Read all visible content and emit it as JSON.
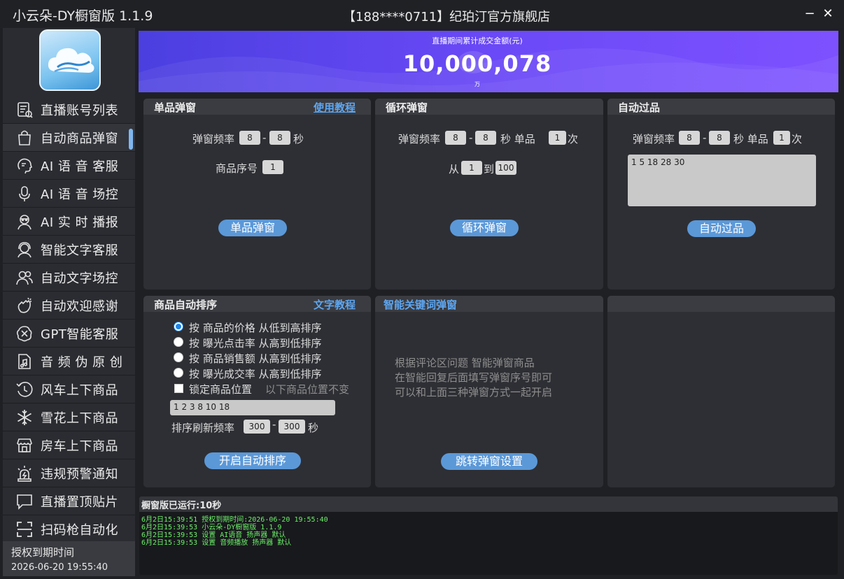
{
  "window": {
    "app_title": "小云朵-DY橱窗版 1.1.9",
    "shop_title": "【188****0711】纪珀汀官方旗舰店",
    "minimize_symbol": "−",
    "close_symbol": "✕"
  },
  "sidebar": {
    "items": [
      {
        "label": "直播账号列表",
        "icon": "account-list-icon"
      },
      {
        "label": "自动商品弹窗",
        "icon": "shopping-bag-icon"
      },
      {
        "label": "AI 语 音 客服",
        "icon": "ai-voice-service-icon"
      },
      {
        "label": "AI 语 音 场控",
        "icon": "microphone-icon"
      },
      {
        "label": "AI 实 时 播报",
        "icon": "broadcaster-icon"
      },
      {
        "label": "智能文字客服",
        "icon": "support-agent-icon"
      },
      {
        "label": "自动文字场控",
        "icon": "users-icon"
      },
      {
        "label": "自动欢迎感谢",
        "icon": "welcome-hand-icon"
      },
      {
        "label": "GPT智能客服",
        "icon": "gpt-icon"
      },
      {
        "label": "音 频 伪 原 创",
        "icon": "music-file-icon"
      },
      {
        "label": "风车上下商品",
        "icon": "clock-history-icon"
      },
      {
        "label": "雪花上下商品",
        "icon": "snowflake-icon"
      },
      {
        "label": "房车上下商品",
        "icon": "store-icon"
      },
      {
        "label": "违规预警通知",
        "icon": "alarm-icon"
      },
      {
        "label": "直播置顶贴片",
        "icon": "chat-bubble-icon"
      },
      {
        "label": "扫码枪自动化",
        "icon": "scan-icon"
      }
    ],
    "active_index": 1,
    "auth_label": "授权到期时间",
    "auth_date": "2026-06-20 19:55:40"
  },
  "banner": {
    "caption": "直播期间累计成交金额(元)",
    "value": "10,000,078",
    "unit": "万"
  },
  "single_popup": {
    "title": "单品弹窗",
    "tutorial_link": "使用教程",
    "freq_label": "弹窗频率",
    "freq_min": "8",
    "dash": "-",
    "freq_max": "8",
    "sec_label": "秒",
    "index_label": "商品序号",
    "index_value": "1",
    "button": "单品弹窗"
  },
  "loop_popup": {
    "title": "循环弹窗",
    "freq_label": "弹窗频率",
    "freq_min": "8",
    "dash": "-",
    "freq_max": "8",
    "sec_single_label": "秒 单品",
    "times_value": "1",
    "times_label": "次",
    "from_label": "从",
    "from_value": "1",
    "to_label": "到",
    "to_value": "100",
    "button": "循环弹窗"
  },
  "auto_pass": {
    "title": "自动过品",
    "freq_label": "弹窗频率",
    "freq_min": "8",
    "dash": "-",
    "freq_max": "8",
    "sec_single_label": "秒 单品",
    "times_value": "1",
    "times_label": "次",
    "list_value": "1 5 18 28 30",
    "button": "自动过品"
  },
  "auto_sort": {
    "title": "商品自动排序",
    "tutorial_link": "文字教程",
    "options": [
      {
        "label": "按 商品的价格 从低到高排序",
        "selected": true
      },
      {
        "label": "按 曝光点击率 从高到低排序",
        "selected": false
      },
      {
        "label": "按 商品销售额 从高到低排序",
        "selected": false
      },
      {
        "label": "按 曝光成交率 从高到低排序",
        "selected": false
      }
    ],
    "lock_label": "锁定商品位置",
    "lock_hint": "以下商品位置不变",
    "lock_checked": false,
    "lock_list": "1 2 3 8 10 18",
    "refresh_label": "排序刷新频率",
    "refresh_min": "300",
    "dash": "-",
    "refresh_max": "300",
    "sec_label": "秒",
    "button": "开启自动排序"
  },
  "keyword_popup": {
    "title": "智能关键词弹窗",
    "desc_line1": "根据评论区问题  智能弹窗商品",
    "desc_line2": "在智能回复后面填写弹窗序号即可",
    "desc_line3": "可以和上面三种弹窗方式一起开启",
    "button": "跳转弹窗设置"
  },
  "log": {
    "header": "橱窗版已运行:10秒",
    "lines": [
      "6月2日15:39:51 授权到期时间:2026-06-20 19:55:40",
      "6月2日15:39:53 小云朵-DY橱窗版 1.1.9",
      "6月2日15:39:53 设置 AI语音 扬声器 默认",
      "6月2日15:39:53 设置 音频播放 扬声器 默认"
    ]
  },
  "colors": {
    "accent": "#5ea6f0",
    "button": "#5b98d8",
    "log_text": "#6cf06a",
    "banner_start": "#4b3fe0",
    "banner_end": "#7e51ff"
  }
}
